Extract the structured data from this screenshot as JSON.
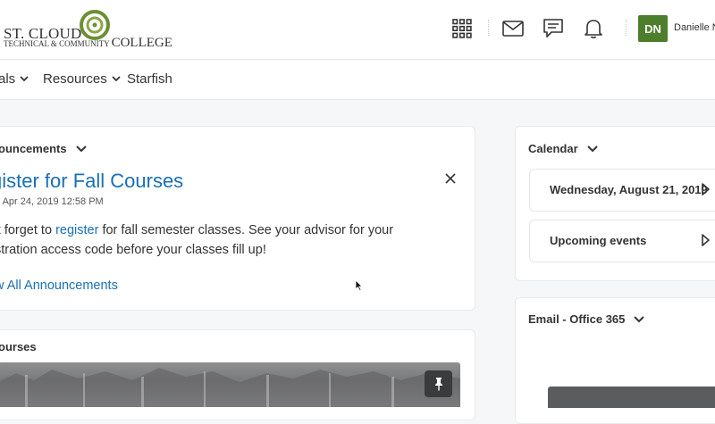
{
  "header": {
    "logo_line1": "ST. CLOUD",
    "logo_line2_small": "TECHNICAL & COMMUNITY",
    "logo_line2_big": "COLLEGE",
    "avatar_initials": "DN",
    "user_name": "Danielle N",
    "icons": [
      "apps-grid-icon",
      "mail-icon",
      "chat-icon",
      "bell-icon"
    ]
  },
  "nav": {
    "items": [
      {
        "label": "als"
      },
      {
        "label": "Resources"
      },
      {
        "label": "Starfish"
      }
    ]
  },
  "announcements": {
    "header": "ouncements",
    "title": "gister for Fall Courses",
    "date": "d Apr 24, 2019 12:58 PM",
    "body_pre": "'t forget to ",
    "body_link": "register",
    "body_post": " for fall semester classes. See your advisor for your",
    "body_line2": "stration access code before your classes fill up!",
    "view_all": "w All Announcements"
  },
  "courses": {
    "header": "ourses"
  },
  "calendar": {
    "header": "Calendar",
    "date_row": "Wednesday, August 21, 2019",
    "upcoming": "Upcoming events"
  },
  "email": {
    "header": "Email - Office 365"
  },
  "colors": {
    "link": "#1a6fb5",
    "avatar": "#4d7e2b",
    "logo_green": "#6c8f34"
  }
}
